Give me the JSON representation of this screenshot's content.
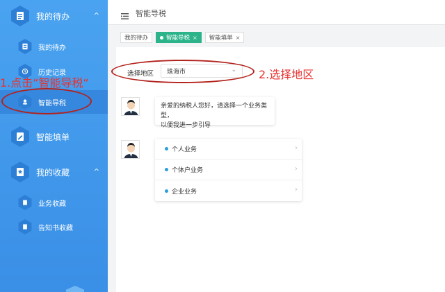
{
  "sidebar": {
    "items": [
      {
        "label": "我的待办",
        "level": 1,
        "icon": "document-icon",
        "caret": "^"
      },
      {
        "label": "我的待办",
        "level": 2,
        "icon": "document-icon"
      },
      {
        "label": "历史记录",
        "level": 2,
        "icon": "history-icon"
      },
      {
        "label": "智能导税",
        "level": 2,
        "icon": "guide-icon",
        "active": true
      },
      {
        "label": "智能填单",
        "level": 1,
        "icon": "form-icon"
      },
      {
        "label": "我的收藏",
        "level": 1,
        "icon": "favorites-icon",
        "caret": "^"
      },
      {
        "label": "业务收藏",
        "level": 2,
        "icon": "bookmark-icon"
      },
      {
        "label": "告知书收藏",
        "level": 2,
        "icon": "bookmark-icon"
      }
    ]
  },
  "header": {
    "title": "智能导税"
  },
  "tabs": [
    {
      "label": "我的待办"
    },
    {
      "label": "智能导税",
      "active": true,
      "close": "×"
    },
    {
      "label": "智能填单",
      "close": "×"
    }
  ],
  "region": {
    "label": "选择地区",
    "value": "珠海市"
  },
  "chat": {
    "greeting": "亲爱的纳税人您好，请选择一个业务类型，以便我进一步引导",
    "greeting_line1": "亲爱的纳税人您好，请选择一个业务类型，",
    "greeting_line2": "以便我进一步引导",
    "options": [
      "个人业务",
      "个体户业务",
      "企业业务"
    ]
  },
  "annotations": {
    "step1": "1.点击“智能导税“",
    "step2": "2.选择地区",
    "color": "#e8312f"
  },
  "colors": {
    "sidebar": "#4aa3f0",
    "active_tab": "#2cb38a",
    "bullet": "#2a9fd8"
  }
}
